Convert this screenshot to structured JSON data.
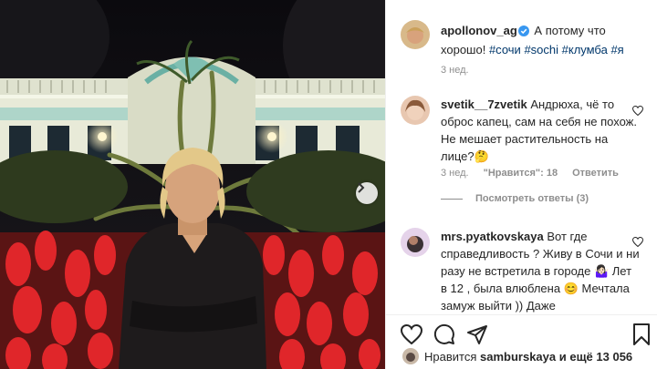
{
  "post": {
    "author": "apollonov_ag",
    "caption_text": "А потому что хорошо!",
    "hashtags": [
      "#сочи",
      "#sochi",
      "#клумба",
      "#я"
    ],
    "time": "3 нед."
  },
  "comments": [
    {
      "user": "svetik__7zvetik",
      "text": "Андрюха, чё то оброс капец, сам на себя не похож. Не мешает растительность на лице?🤔",
      "time": "3 нед.",
      "likes": "\"Нравится\": 18",
      "reply_label": "Ответить"
    },
    {
      "user": "mrs.pyatkovskaya",
      "text": "Вот где справедливость ? Живу в Сочи и ни разу не встретила в городе 🤷🏻‍♀️ Лет в 12 , была влюблена 😊 Мечтала замуж выйти )) Даже"
    }
  ],
  "replies_label": "Посмотреть ответы (3)",
  "likes_bar": {
    "prefix": "Нравится",
    "user": "samburskaya",
    "suffix": "и ещё 13 056"
  },
  "icons": [
    "verified-icon",
    "heart-icon",
    "comment-icon",
    "share-icon",
    "bookmark-icon",
    "chevron-right-icon"
  ],
  "colors": {
    "link": "#00376b",
    "verified": "#3897f0",
    "muted": "#8e8e8e"
  }
}
